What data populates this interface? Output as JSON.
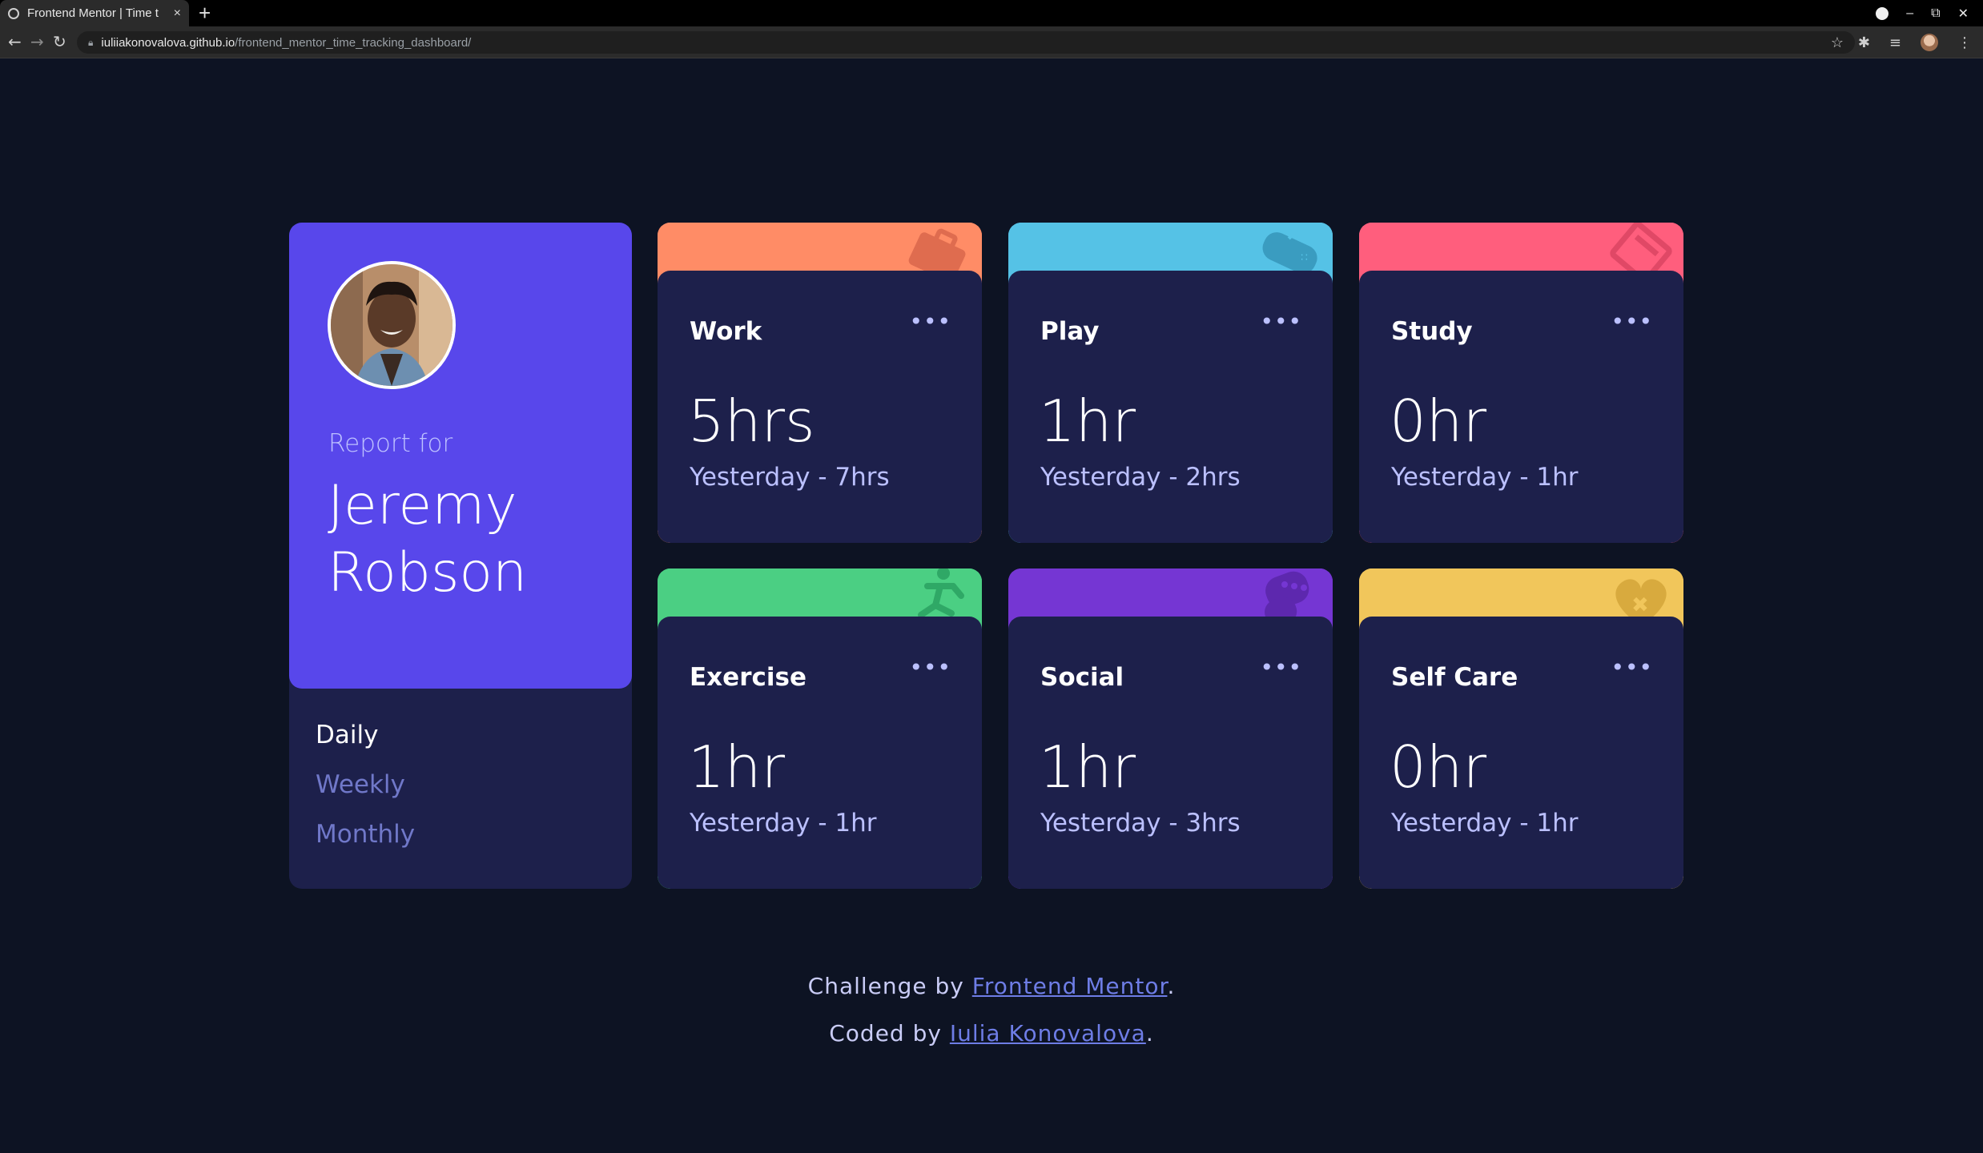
{
  "browser": {
    "tab_title": "Frontend Mentor | Time t",
    "tab_close": "×",
    "new_tab": "+",
    "url_host": "iuliiakonovalova.github.io",
    "url_path": "/frontend_mentor_time_tracking_dashboard/",
    "window_controls": {
      "minimize": "–",
      "maximize": "⧉",
      "close": "✕"
    }
  },
  "profile": {
    "report_for": "Report for",
    "name": "Jeremy Robson",
    "timeframes": [
      "Daily",
      "Weekly",
      "Monthly"
    ],
    "active_timeframe": "Daily"
  },
  "activities": [
    {
      "title": "Work",
      "current": "5hrs",
      "previous": "Yesterday - 7hrs",
      "color": "#ff8c66",
      "icon": "briefcase-icon"
    },
    {
      "title": "Play",
      "current": "1hr",
      "previous": "Yesterday - 2hrs",
      "color": "#55c2e6",
      "icon": "gamepad-icon"
    },
    {
      "title": "Study",
      "current": "0hr",
      "previous": "Yesterday - 1hr",
      "color": "#ff5e7d",
      "icon": "book-icon"
    },
    {
      "title": "Exercise",
      "current": "1hr",
      "previous": "Yesterday - 1hr",
      "color": "#4bcf83",
      "icon": "runner-icon"
    },
    {
      "title": "Social",
      "current": "1hr",
      "previous": "Yesterday - 3hrs",
      "color": "#7536d3",
      "icon": "chat-bubble-icon"
    },
    {
      "title": "Self Care",
      "current": "0hr",
      "previous": "Yesterday - 1hr",
      "color": "#f1c65b",
      "icon": "heart-bandage-icon"
    }
  ],
  "ellipsis": "•••",
  "footer": {
    "challenge_prefix": "Challenge by",
    "challenge_link": "Frontend Mentor",
    "coded_prefix": "Coded by",
    "coded_link": "Iulia Konovalova",
    "period": "."
  },
  "colors": {
    "background": "#0d1323",
    "card": "#1d204b",
    "primary": "#5847eb",
    "muted_text": "#bbc0ff"
  }
}
